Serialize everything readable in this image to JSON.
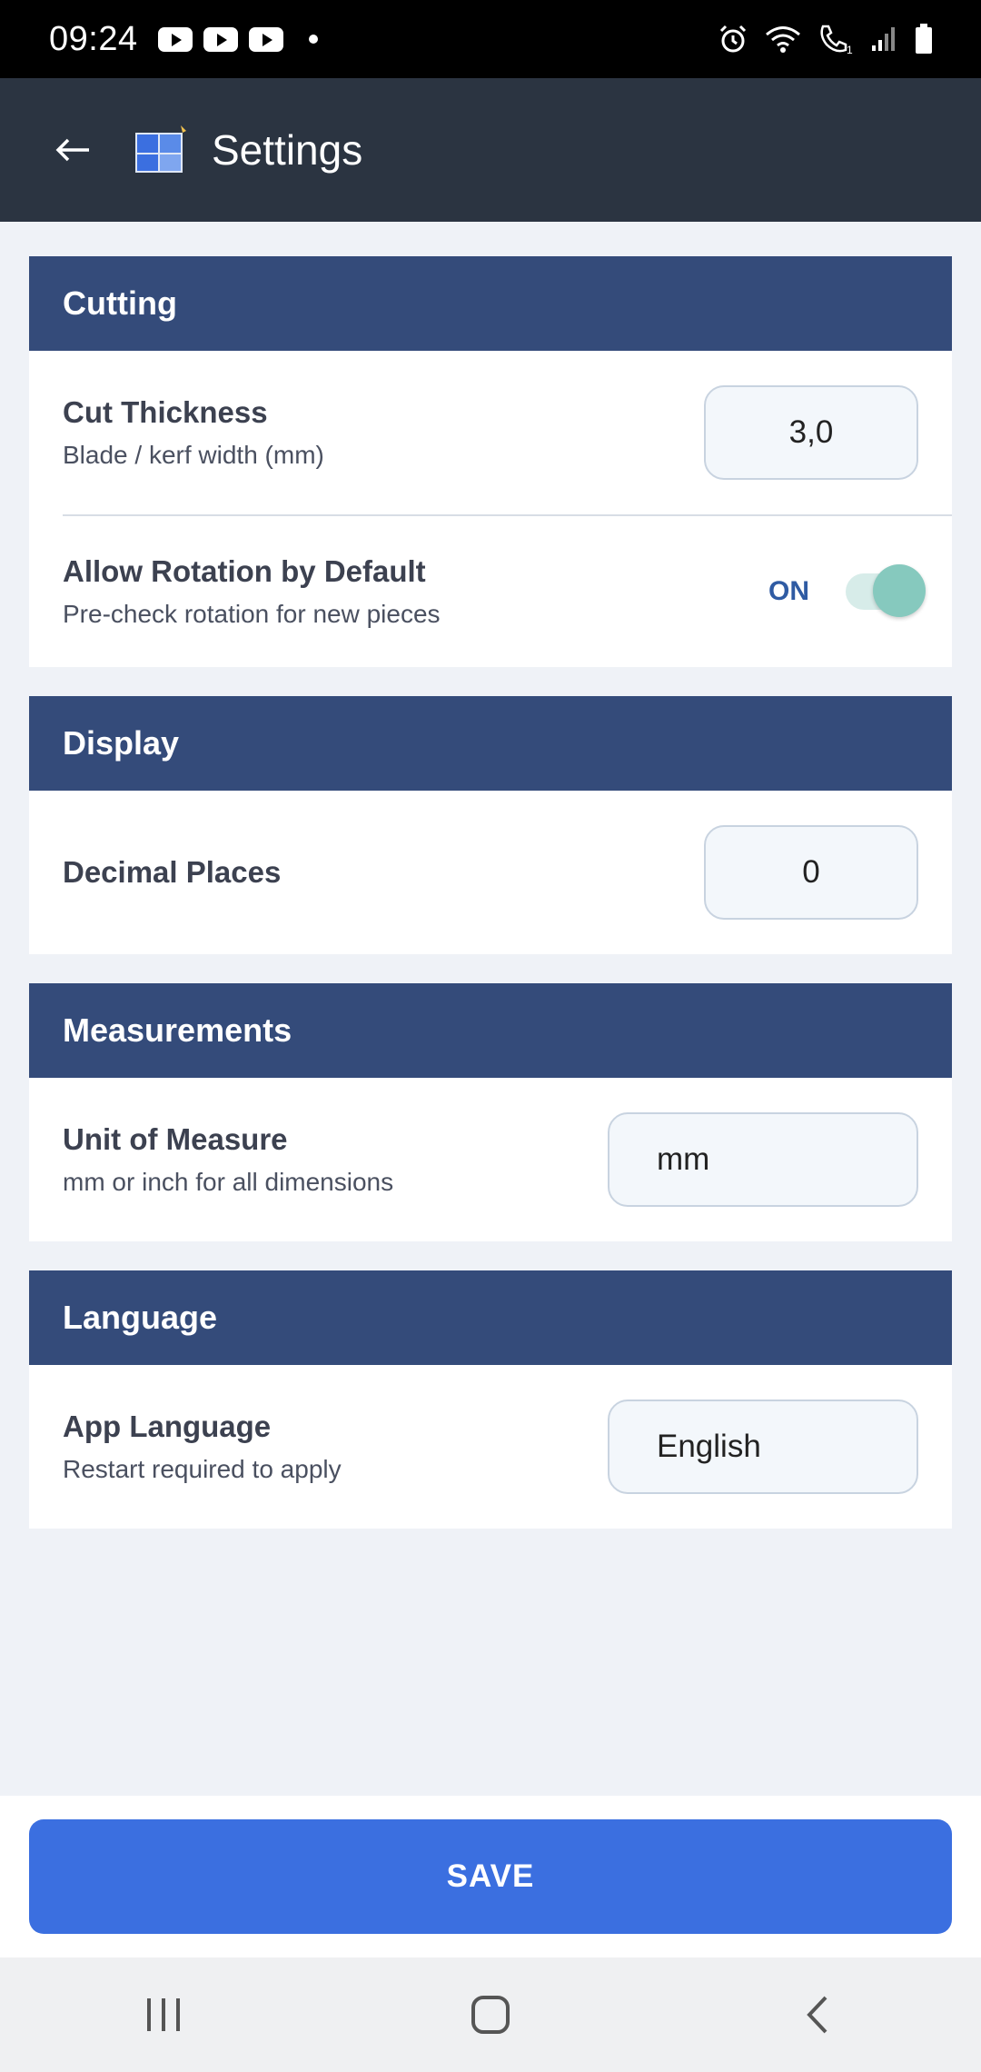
{
  "status_bar": {
    "time": "09:24",
    "icons": [
      "youtube-icon",
      "youtube-icon",
      "youtube-icon",
      "dot-icon",
      "alarm-icon",
      "wifi-icon",
      "call-icon",
      "signal-icon",
      "battery-icon"
    ]
  },
  "app_bar": {
    "back_icon": "arrow-left-icon",
    "title": "Settings"
  },
  "sections": {
    "cutting": {
      "header": "Cutting",
      "cut_thickness": {
        "title": "Cut Thickness",
        "subtitle": "Blade / kerf width (mm)",
        "value": "3,0"
      },
      "allow_rotation": {
        "title": "Allow Rotation by Default",
        "subtitle": "Pre-check rotation for new pieces",
        "state_label": "ON",
        "enabled": true
      }
    },
    "display": {
      "header": "Display",
      "decimal_places": {
        "title": "Decimal Places",
        "value": "0"
      }
    },
    "measurements": {
      "header": "Measurements",
      "unit": {
        "title": "Unit of Measure",
        "subtitle": "mm or inch for all dimensions",
        "value": "mm"
      }
    },
    "language": {
      "header": "Language",
      "app_language": {
        "title": "App Language",
        "subtitle": "Restart required to apply",
        "value": "English"
      }
    }
  },
  "footer": {
    "save_label": "SAVE"
  },
  "colors": {
    "app_bar": "#2b3441",
    "section_header": "#344b7a",
    "save_button": "#3b6fe0",
    "toggle_on_label": "#2f5ba3",
    "toggle_knob": "#86c9be",
    "page_background": "#eff2f7"
  }
}
